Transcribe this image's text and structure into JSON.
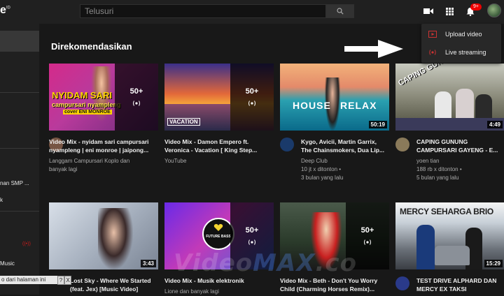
{
  "header": {
    "logo_fragment": "e",
    "logo_super": "ID",
    "search_placeholder": "Telusuri",
    "notification_count": "9+"
  },
  "sidebar": {
    "items": [
      "nan SMP ...",
      "k",
      "Music"
    ]
  },
  "section_title": "Direkomendasikan",
  "dropdown": {
    "items": [
      {
        "label": "Upload video",
        "icon": "upload-video-icon"
      },
      {
        "label": "Live streaming",
        "icon": "live-streaming-icon"
      }
    ]
  },
  "thumb_texts": {
    "nyidam_title": "NYIDAM SARI",
    "nyidam_sub": "campursari nyampleng",
    "nyidam_cover": "cover ENI MONROE",
    "vacation": "VACATION",
    "house": "HOUSE",
    "relax": "RELAX",
    "caping": "CAPING GUNUNG",
    "future_bass": "FUTURE BASS",
    "mercy": "MERCY SEHARGA BRIO"
  },
  "row1": [
    {
      "title_line1": "Video Mix - nyidam sari campursari",
      "title_line2": "nyampleng | eni monroe | jaipong...",
      "meta1": "Langgam Campursari Koplo dan",
      "meta2": "banyak lagi",
      "meta3": "",
      "playlist_count": "50+",
      "duration": ""
    },
    {
      "title_line1": "Video Mix - Damon Empero ft.",
      "title_line2": "Veronica - Vacation [ King Step...",
      "meta1": "YouTube",
      "meta2": "",
      "meta3": "",
      "playlist_count": "50+",
      "duration": ""
    },
    {
      "title_line1": "Kygo, Avicii, Martin Garrix,",
      "title_line2": "The Chainsmokers, Dua Lip...",
      "meta1": "Deep Club",
      "meta2": "10 jt x ditonton •",
      "meta3": "3 bulan yang lalu",
      "playlist_count": "",
      "duration": "50:19"
    },
    {
      "title_line1": "CAPING GUNUNG",
      "title_line2": "CAMPURSARI GAYENG - E...",
      "meta1": "yoen tian",
      "meta2": "188 rb x ditonton •",
      "meta3": "5 bulan yang lalu",
      "playlist_count": "",
      "duration": "4:49"
    }
  ],
  "row2": [
    {
      "title_line1": "Lost Sky - Where We Started",
      "title_line2": "(feat. Jex) [Music Video]",
      "meta1": "",
      "playlist_count": "",
      "duration": "3:43"
    },
    {
      "title_line1": "Video Mix - Musik elektronik",
      "title_line2": "",
      "meta1": "Lione dan banyak lagi",
      "playlist_count": "50+",
      "duration": ""
    },
    {
      "title_line1": "Video Mix - Beth - Don't You Worry",
      "title_line2": "Child (Charming Horses Remix)...",
      "meta1": "",
      "playlist_count": "50+",
      "duration": ""
    },
    {
      "title_line1": "TEST DRIVE ALPHARD DAN",
      "title_line2": "MERCY EX TAKSI",
      "meta1": "",
      "playlist_count": "",
      "duration": "15:29"
    }
  ],
  "watermark": {
    "part1": "Video",
    "part2": "MAX",
    "part3": ".co"
  },
  "translate_bar": {
    "text": "o dari halaman ini",
    "btn1": "?",
    "btn2": "X"
  },
  "colors": {
    "background": "#181818",
    "header": "#202020",
    "badge": "#ee0000",
    "live": "#cc1a1a"
  }
}
